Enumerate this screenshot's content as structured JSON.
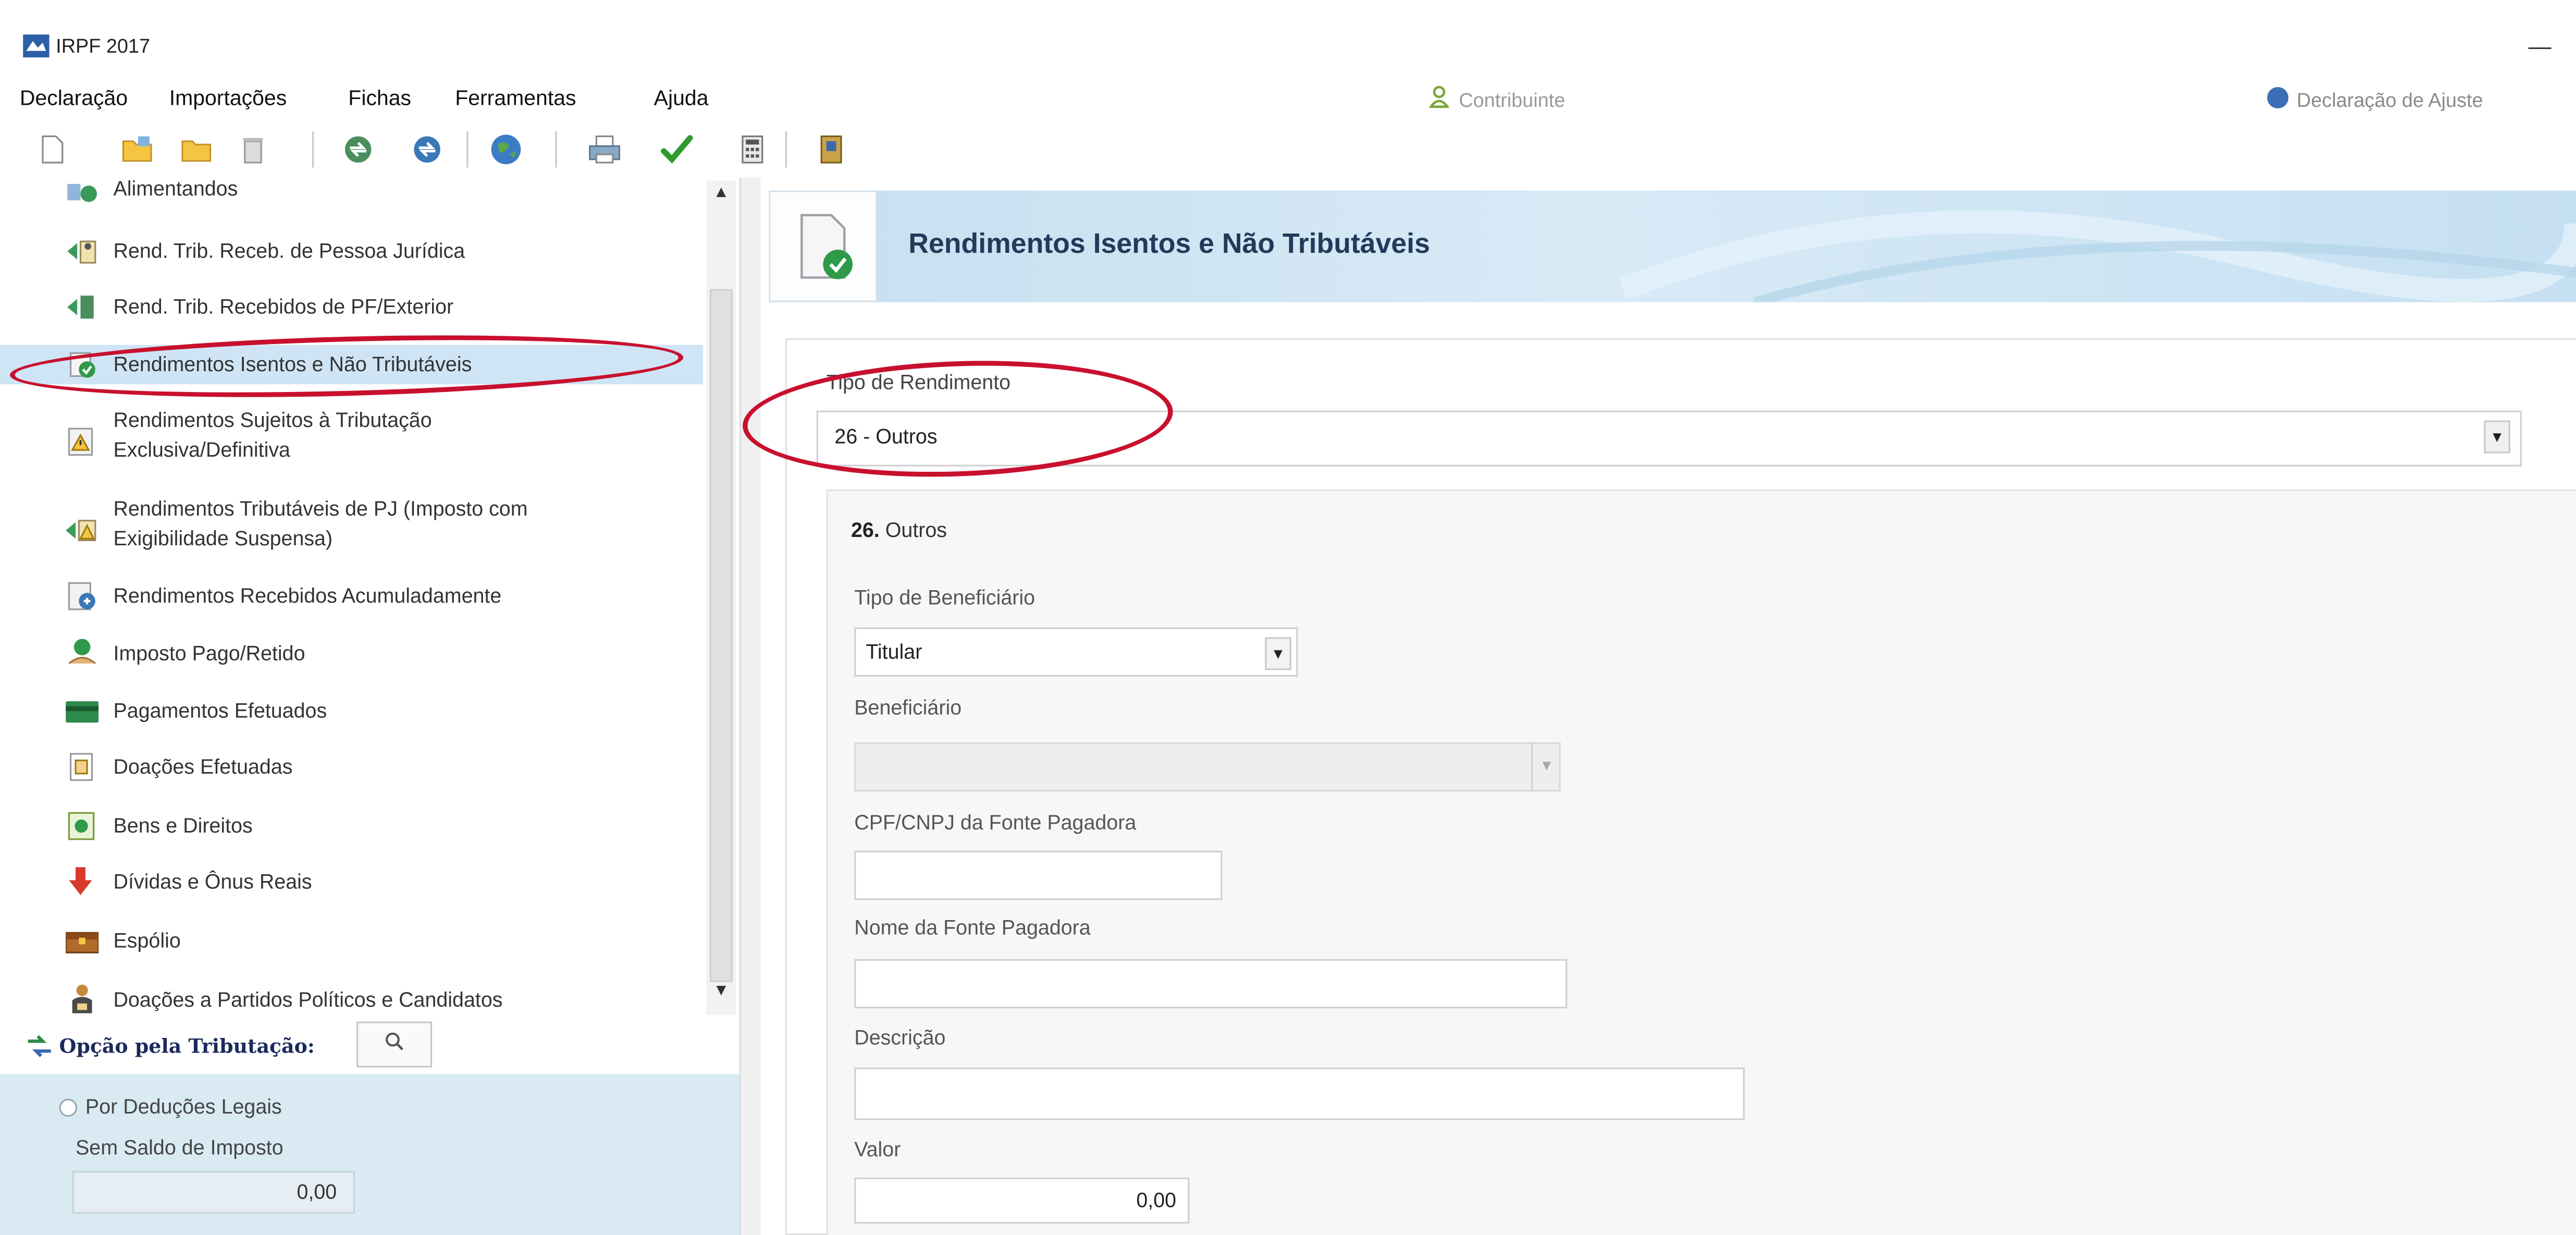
{
  "window": {
    "title": "IRPF 2017",
    "minimize_glyph": "—"
  },
  "menu": {
    "items": [
      {
        "label": "Declaração"
      },
      {
        "label": "Importações"
      },
      {
        "label": "Fichas"
      },
      {
        "label": "Ferramentas"
      },
      {
        "label": "Ajuda"
      }
    ],
    "contribuinte_label": "Contribuinte",
    "declaracao_label": "Declaração de Ajuste"
  },
  "toolbar": {
    "icons": [
      "new-document-icon",
      "open-folder-icon",
      "folder-icon",
      "trash-icon",
      "transmit-icon",
      "receive-icon",
      "globe-icon",
      "print-icon",
      "check-icon",
      "calculator-icon",
      "book-icon"
    ]
  },
  "tree": {
    "items": [
      {
        "label": "Alimentandos",
        "icon": "alimentandos-icon"
      },
      {
        "label": "Rend. Trib. Receb. de Pessoa Jurídica",
        "icon": "rend-pj-icon"
      },
      {
        "label": "Rend. Trib. Recebidos de PF/Exterior",
        "icon": "rend-pf-icon"
      },
      {
        "label": "Rendimentos Isentos e Não Tributáveis",
        "icon": "isentos-icon",
        "selected": true
      },
      {
        "label": "Rendimentos Sujeitos à Tributação",
        "label2": "Exclusiva/Definitiva",
        "icon": "exclusiva-icon"
      },
      {
        "label": "Rendimentos Tributáveis de PJ (Imposto com",
        "label2": "Exigibilidade Suspensa)",
        "icon": "suspensa-icon"
      },
      {
        "label": "Rendimentos Recebidos Acumuladamente",
        "icon": "acumulados-icon"
      },
      {
        "label": "Imposto Pago/Retido",
        "icon": "imposto-pago-icon"
      },
      {
        "label": "Pagamentos Efetuados",
        "icon": "pagamentos-icon"
      },
      {
        "label": "Doações Efetuadas",
        "icon": "doacoes-icon"
      },
      {
        "label": "Bens e Direitos",
        "icon": "bens-icon"
      },
      {
        "label": "Dívidas e Ônus Reais",
        "icon": "dividas-icon"
      },
      {
        "label": "Espólio",
        "icon": "espolio-icon"
      },
      {
        "label": "Doações a Partidos Políticos e Candidatos",
        "icon": "partidos-icon"
      }
    ]
  },
  "opcao": {
    "label": "Opção pela Tributação:",
    "radio_label": "Por Deduções Legais",
    "saldo_label": "Sem Saldo de Imposto",
    "saldo_value": "0,00"
  },
  "content": {
    "title": "Rendimentos Isentos e Não Tributáveis",
    "tipo_label": "Tipo de Rendimento",
    "tipo_value": "26 - Outros",
    "section_number": "26.",
    "section_name": "Outros",
    "fields": {
      "tipo_beneficiario_label": "Tipo de Beneficiário",
      "tipo_beneficiario_value": "Titular",
      "beneficiario_label": "Beneficiário",
      "beneficiario_value": "",
      "cpf_label": "CPF/CNPJ da Fonte Pagadora",
      "cpf_value": "",
      "nome_label": "Nome da Fonte Pagadora",
      "nome_value": "",
      "descricao_label": "Descrição",
      "descricao_value": "",
      "valor_label": "Valor",
      "valor_value": "0,00"
    }
  },
  "colors": {
    "annotation_red": "#c8102e",
    "header_blue": "#c6dff0",
    "title_navy": "#223a5a",
    "selected_bg": "#cfe5f5",
    "panel_blue": "#d9eaf3"
  }
}
